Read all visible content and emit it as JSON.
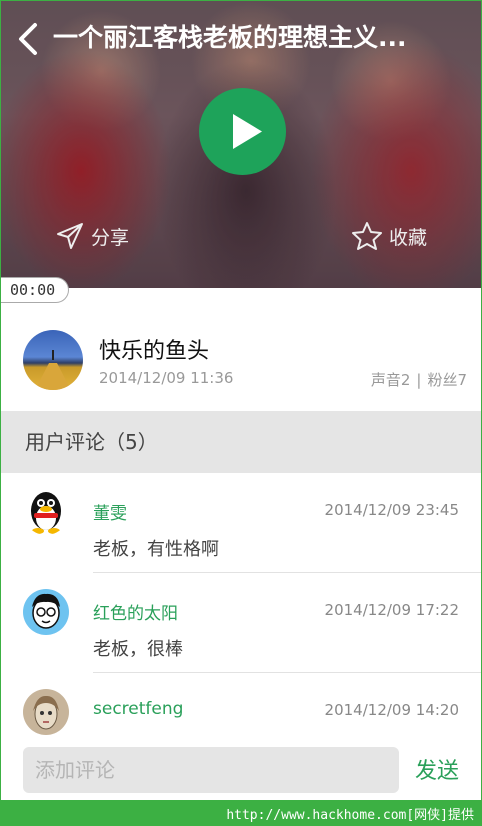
{
  "header": {
    "title": "一个丽江客栈老板的理想主义...",
    "back_icon": "chevron-left-icon",
    "play_icon": "play-icon",
    "share_label": "分享",
    "favorite_label": "收藏",
    "time": "00:00",
    "accent_color": "#1ea35a"
  },
  "author": {
    "name": "快乐的鱼头",
    "date": "2014/12/09 11:36",
    "sounds": "声音2",
    "separator": "|",
    "fans": "粉丝7"
  },
  "comments_section": {
    "heading": "用户评论（5）"
  },
  "comments": [
    {
      "name": "董雯",
      "time": "2014/12/09 23:45",
      "text": "老板，有性格啊"
    },
    {
      "name": "红色的太阳",
      "time": "2014/12/09 17:22",
      "text": "老板，很棒"
    },
    {
      "name": "secretfeng",
      "time": "2014/12/09 14:20",
      "text": ""
    }
  ],
  "input_bar": {
    "placeholder": "添加评论",
    "send_label": "发送"
  },
  "footer": {
    "watermark": "http://www.hackhome.com[网侠]提供"
  }
}
